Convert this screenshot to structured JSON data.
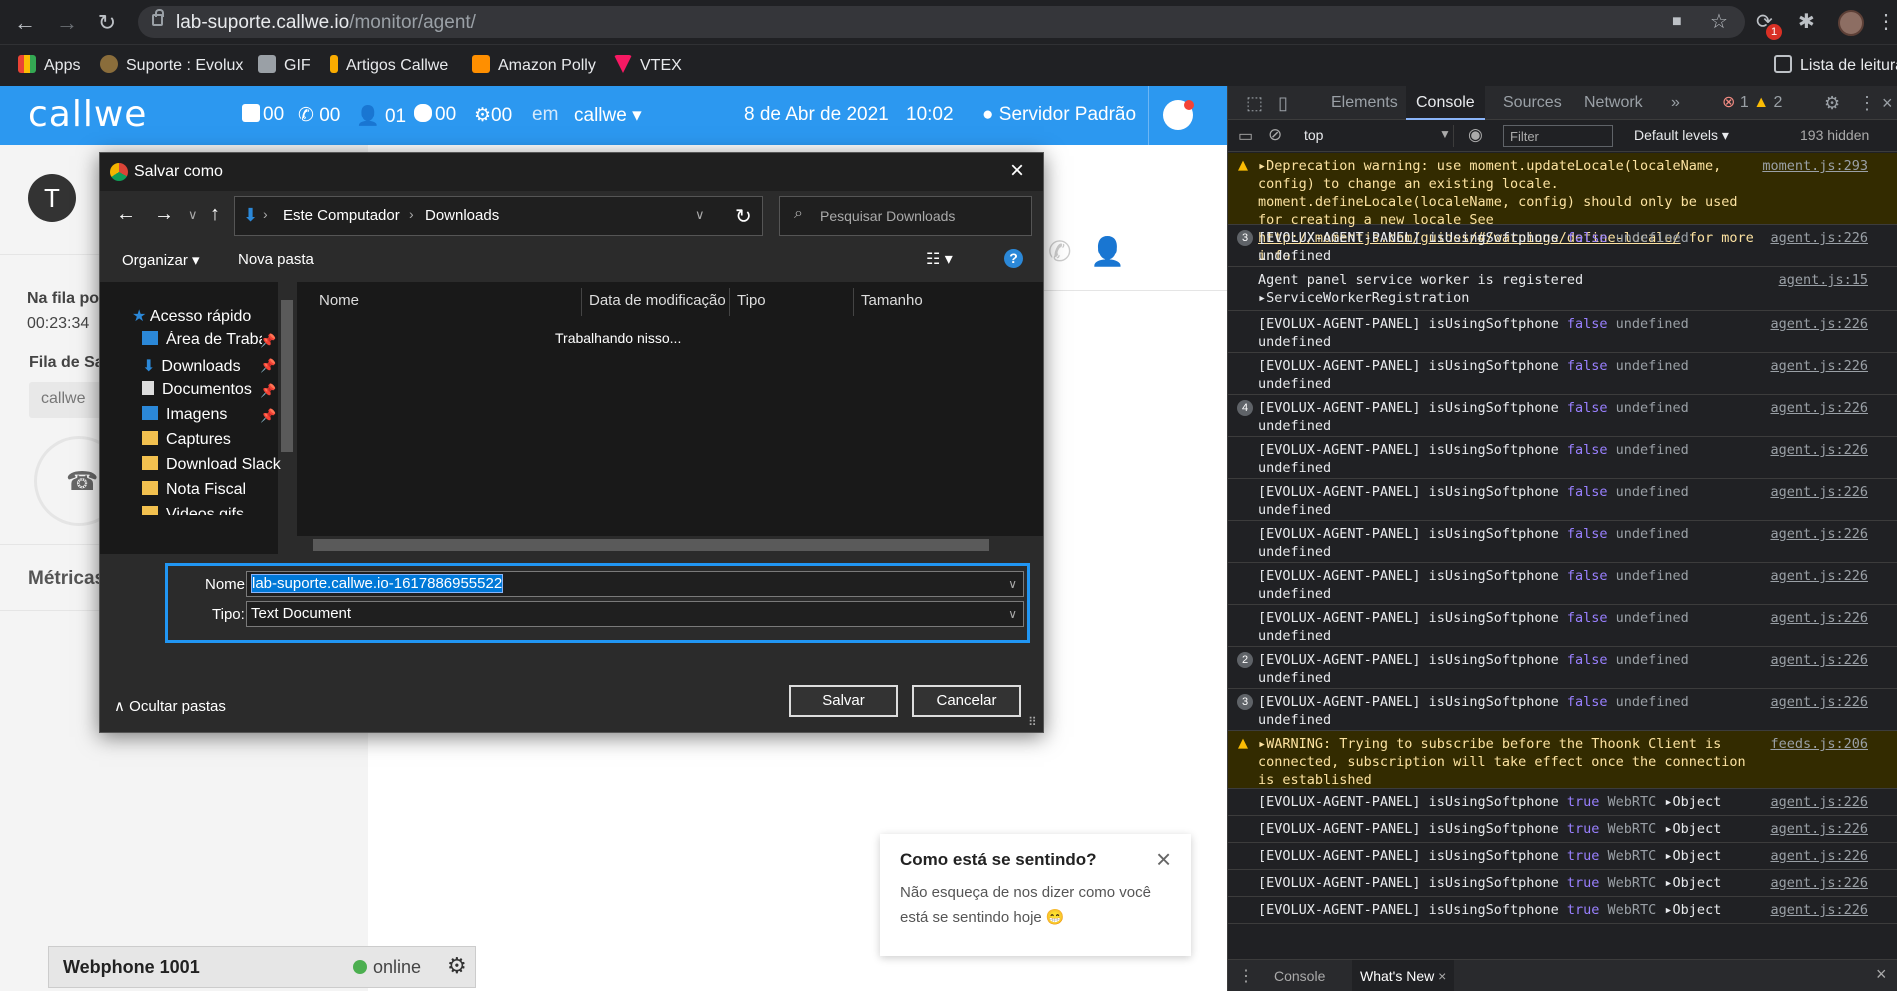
{
  "browser": {
    "url_host": "lab-suporte.callwe.io",
    "url_path": "/monitor/agent/",
    "ext_badge": "1",
    "bookmarks": [
      {
        "label": "Apps",
        "color": "#4285f4"
      },
      {
        "label": "Suporte : Evolux",
        "color": "#8a6d3b"
      },
      {
        "label": "GIF",
        "color": "#9aa0a6"
      },
      {
        "label": "Artigos Callwe",
        "color": "#f9ab00"
      },
      {
        "label": "Amazon Polly",
        "color": "#ff8f00"
      },
      {
        "label": "VTEX",
        "color": "#f71963"
      }
    ],
    "reading_list": "Lista de leitura"
  },
  "app": {
    "logo": "callwe",
    "stats": [
      "00",
      "00",
      "01",
      "00",
      "00"
    ],
    "em_label": "em",
    "account": "callwe",
    "date": "8 de Abr de 2021",
    "time": "10:02",
    "server": "Servidor Padrão",
    "avatar_letter": "T",
    "queue_label": "Na fila po",
    "queue_time": "00:23:34",
    "fila_label": "Fila de Sa",
    "fila_value": "callwe",
    "metricas": "Métricas"
  },
  "webphone": {
    "title": "Webphone 1001",
    "status": "online"
  },
  "toast": {
    "title": "Como está se sentindo?",
    "body": "Não esqueça de nos dizer como você está se sentindo hoje 😁"
  },
  "dialog": {
    "title": "Salvar como",
    "breadcrumb": [
      "Este Computador",
      "Downloads"
    ],
    "search_placeholder": "Pesquisar Downloads",
    "organize": "Organizar",
    "new_folder": "Nova pasta",
    "nav": [
      {
        "label": "Acesso rápido",
        "type": "star"
      },
      {
        "label": "Área de Traba",
        "type": "desktop",
        "pinned": true
      },
      {
        "label": "Downloads",
        "type": "download",
        "pinned": true
      },
      {
        "label": "Documentos",
        "type": "doc",
        "pinned": true
      },
      {
        "label": "Imagens",
        "type": "image",
        "pinned": true
      },
      {
        "label": "Captures",
        "type": "folder"
      },
      {
        "label": "Download Slack",
        "type": "folder"
      },
      {
        "label": "Nota Fiscal",
        "type": "folder"
      },
      {
        "label": "Videos gifs",
        "type": "folder"
      }
    ],
    "columns": [
      "Nome",
      "Data de modificação",
      "Tipo",
      "Tamanho"
    ],
    "working": "Trabalhando nisso...",
    "name_label": "Nome:",
    "name_value": "lab-suporte.callwe.io-1617886955522",
    "type_label": "Tipo:",
    "type_value": "Text Document",
    "hide_folders": "Ocultar pastas",
    "save": "Salvar",
    "cancel": "Cancelar"
  },
  "devtools": {
    "tabs": [
      "Elements",
      "Console",
      "Sources",
      "Network",
      "»"
    ],
    "errors": "1",
    "warnings": "2",
    "context": "top",
    "filter_placeholder": "Filter",
    "levels": "Default levels ▾",
    "hidden": "193 hidden",
    "bottom_tabs": [
      "Console",
      "What's New"
    ]
  }
}
